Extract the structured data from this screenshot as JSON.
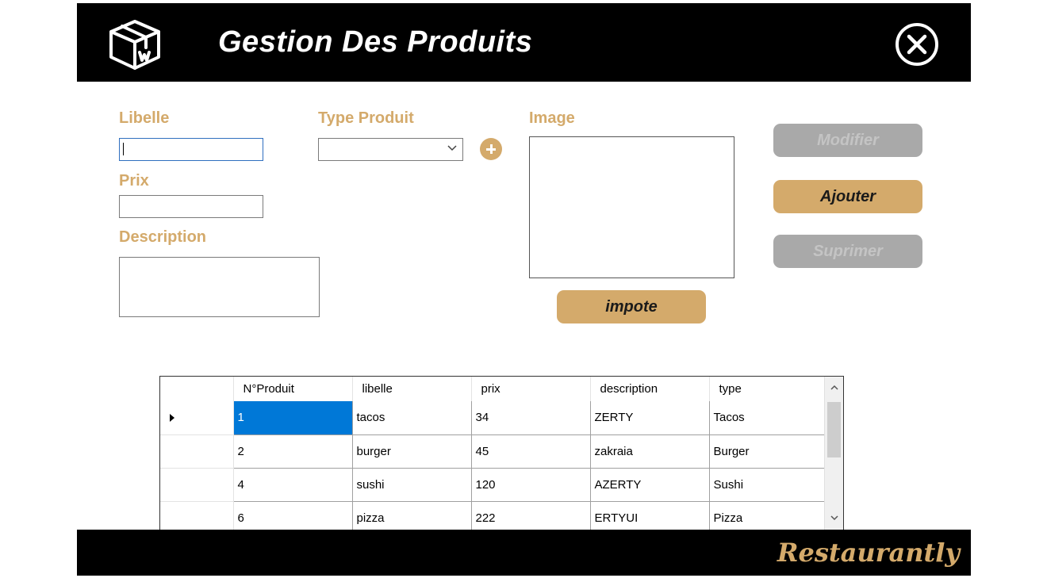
{
  "header": {
    "title": "Gestion Des Produits",
    "icon": "package-box-icon",
    "close_icon": "close-circle-icon"
  },
  "form": {
    "libelle_label": "Libelle",
    "libelle_value": "",
    "prix_label": "Prix",
    "prix_value": "",
    "description_label": "Description",
    "description_value": "",
    "type_label": "Type Produit",
    "type_value": "",
    "image_label": "Image",
    "import_button": "impote"
  },
  "actions": {
    "modifier": "Modifier",
    "ajouter": "Ajouter",
    "supprimer": "Suprimer"
  },
  "grid": {
    "columns": [
      "N°Produit",
      "libelle",
      "prix",
      "description",
      "type"
    ],
    "rows": [
      [
        "1",
        "tacos",
        "34",
        "ZERTY",
        "Tacos"
      ],
      [
        "2",
        "burger",
        "45",
        "zakraia",
        "Burger"
      ],
      [
        "4",
        "sushi",
        "120",
        "AZERTY",
        "Sushi"
      ],
      [
        "6",
        "pizza",
        "222",
        "ERTYUI",
        "Pizza"
      ]
    ],
    "selected_row": 0
  },
  "footer": {
    "brand": "Restaurantly"
  },
  "colors": {
    "accent": "#d4aa6b",
    "header_bg": "#000000",
    "disabled": "#a9a9a9",
    "selection": "#0078d7"
  }
}
